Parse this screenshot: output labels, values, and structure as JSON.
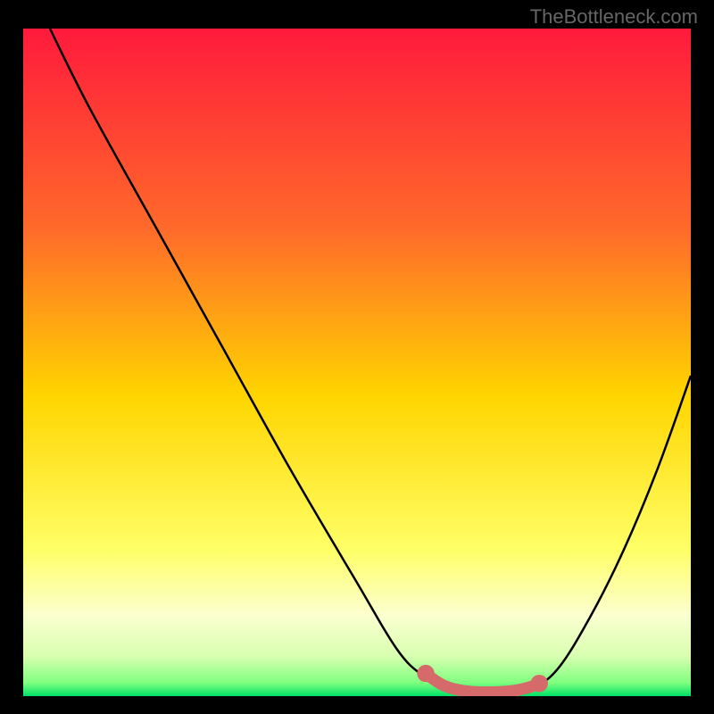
{
  "watermark": "TheBottleneck.com",
  "chart_data": {
    "type": "line",
    "title": "",
    "xlabel": "",
    "ylabel": "",
    "xlim": [
      0,
      100
    ],
    "ylim": [
      0,
      100
    ],
    "background_gradient": {
      "stops": [
        {
          "offset": 0,
          "color": "#ff1a3c"
        },
        {
          "offset": 30,
          "color": "#ff6a2a"
        },
        {
          "offset": 55,
          "color": "#ffd500"
        },
        {
          "offset": 78,
          "color": "#ffff66"
        },
        {
          "offset": 88,
          "color": "#fbffd0"
        },
        {
          "offset": 94,
          "color": "#d8ffb0"
        },
        {
          "offset": 98,
          "color": "#7fff7f"
        },
        {
          "offset": 100,
          "color": "#00e066"
        }
      ]
    },
    "series": [
      {
        "name": "bottleneck-curve",
        "color": "#000000",
        "points": [
          {
            "x": 4,
            "y": 100
          },
          {
            "x": 10,
            "y": 88
          },
          {
            "x": 20,
            "y": 70
          },
          {
            "x": 30,
            "y": 52
          },
          {
            "x": 40,
            "y": 34
          },
          {
            "x": 50,
            "y": 17
          },
          {
            "x": 56,
            "y": 7
          },
          {
            "x": 60,
            "y": 3
          },
          {
            "x": 64,
            "y": 1
          },
          {
            "x": 68,
            "y": 0.6
          },
          {
            "x": 72,
            "y": 0.6
          },
          {
            "x": 76,
            "y": 1.2
          },
          {
            "x": 80,
            "y": 4
          },
          {
            "x": 85,
            "y": 12
          },
          {
            "x": 90,
            "y": 22
          },
          {
            "x": 95,
            "y": 34
          },
          {
            "x": 100,
            "y": 48
          }
        ]
      }
    ],
    "highlight_band": {
      "color": "#d66a6a",
      "points": [
        {
          "x": 60.5,
          "y": 3.2
        },
        {
          "x": 63,
          "y": 1.6
        },
        {
          "x": 66,
          "y": 0.8
        },
        {
          "x": 70,
          "y": 0.6
        },
        {
          "x": 74,
          "y": 0.9
        },
        {
          "x": 77,
          "y": 1.7
        }
      ],
      "endpoints": [
        {
          "x": 60.3,
          "y": 3.4,
          "r": 1.3
        },
        {
          "x": 77.3,
          "y": 1.9,
          "r": 1.3
        }
      ]
    }
  }
}
